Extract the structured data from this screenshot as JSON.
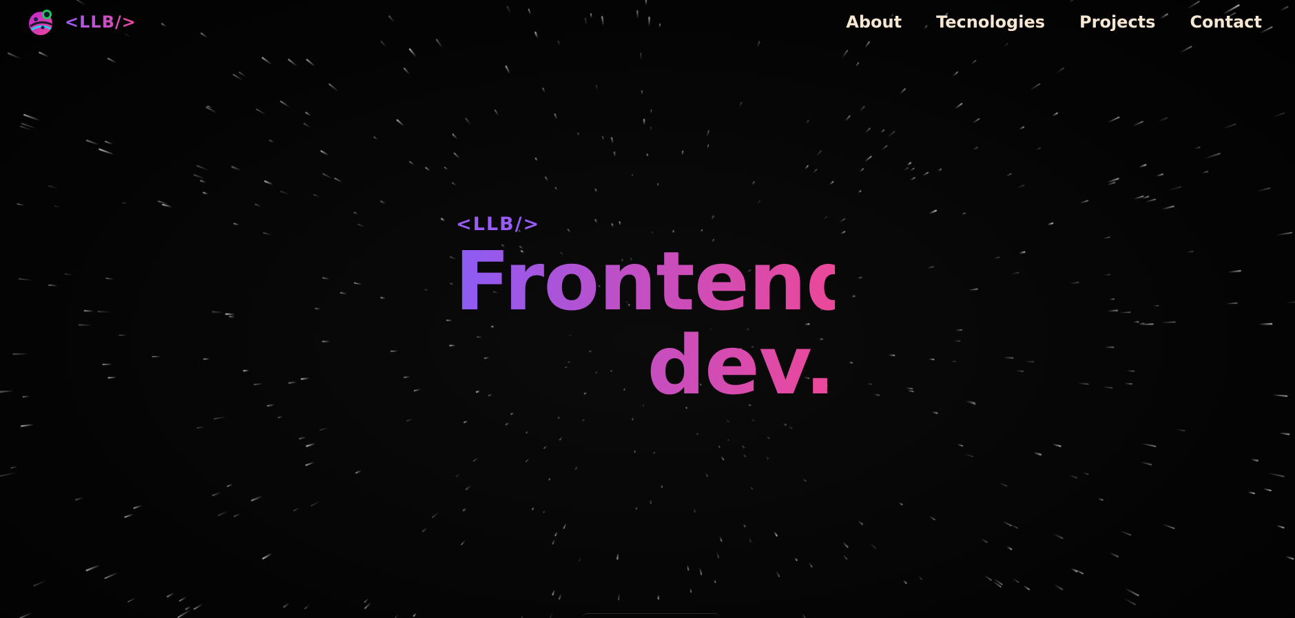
{
  "navbar": {
    "brand_text": "<LLB/>",
    "logo_icon": "astronaut-planet-logo",
    "links": [
      {
        "label": "About"
      },
      {
        "label": "Tecnologies"
      },
      {
        "label": "Projects"
      },
      {
        "label": "Contact"
      }
    ]
  },
  "hero": {
    "tag": "<LLB/>",
    "title_line1": "Frontend",
    "title_line2": "dev."
  },
  "colors": {
    "background": "#050505",
    "nav_text": "#f6e6d2",
    "gradient_start": "#8b5cf6",
    "gradient_end": "#ec4899",
    "stars": "#ffffff"
  }
}
